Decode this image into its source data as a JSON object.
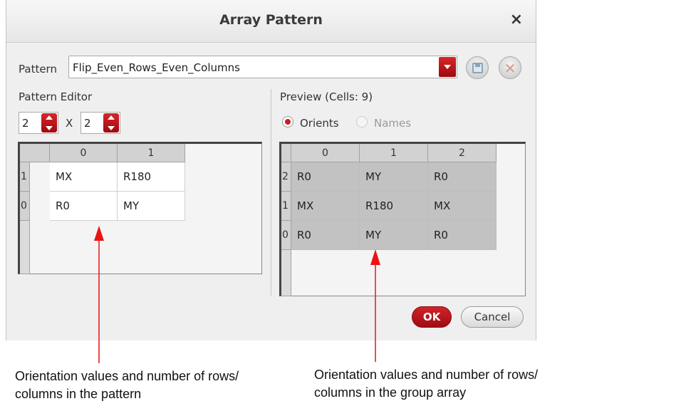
{
  "dialog": {
    "title": "Array Pattern",
    "close_glyph": "×"
  },
  "pattern": {
    "label": "Pattern",
    "value": "Flip_Even_Rows_Even_Columns",
    "icons": [
      "save-icon",
      "delete-icon"
    ],
    "delete_glyph": "✕"
  },
  "editor": {
    "title": "Pattern Editor",
    "rows": "2",
    "separator": "X",
    "cols": "2",
    "col_headers": [
      "0",
      "1"
    ],
    "row_headers": [
      "1",
      "0"
    ],
    "cells": [
      [
        "MX",
        "R180"
      ],
      [
        "R0",
        "MY"
      ]
    ]
  },
  "preview": {
    "title": "Preview (Cells: 9)",
    "radio_orients": "Orients",
    "radio_names": "Names",
    "selected_mode": "Orients",
    "col_headers": [
      "0",
      "1",
      "2"
    ],
    "row_headers": [
      "2",
      "1",
      "0"
    ],
    "cells": [
      [
        "R0",
        "MY",
        "R0"
      ],
      [
        "MX",
        "R180",
        "MX"
      ],
      [
        "R0",
        "MY",
        "R0"
      ]
    ]
  },
  "buttons": {
    "ok": "OK",
    "cancel": "Cancel"
  },
  "annotations": {
    "left": [
      "Orientation values and number of rows/",
      "columns in the pattern"
    ],
    "right": [
      "Orientation values and number of rows/",
      "columns in the group array"
    ]
  },
  "colors": {
    "accent": "#c4161c",
    "annotation_arrow": "#ee1111"
  }
}
